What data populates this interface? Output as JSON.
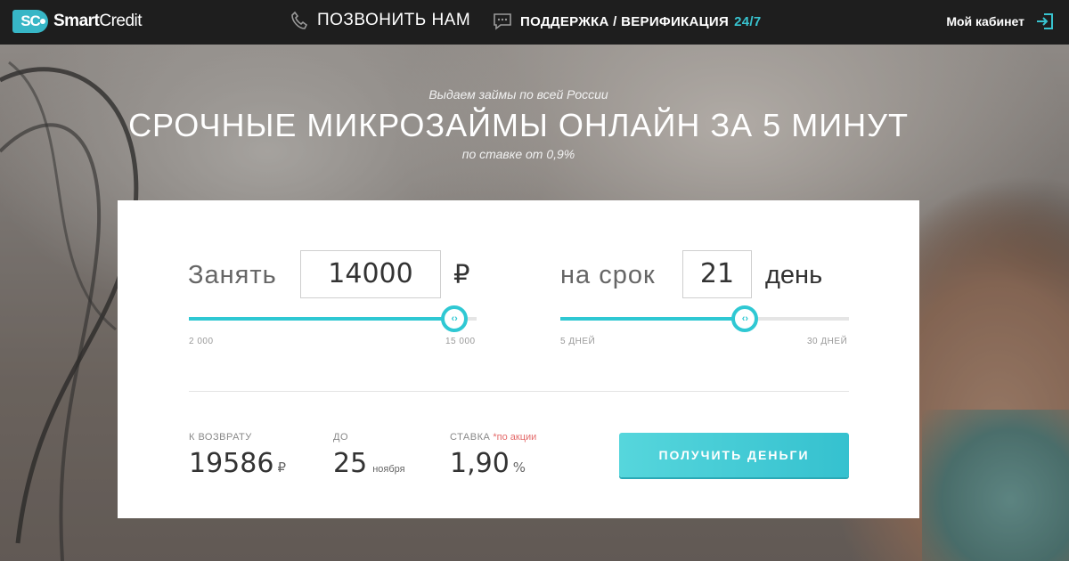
{
  "colors": {
    "accent": "#2fc8d3",
    "header_bg": "#1e1e1e",
    "promo": "#e46a6a"
  },
  "header": {
    "logo_badge": "SC",
    "logo_word1": "Smart",
    "logo_word2": "Credit",
    "call_label": "ПОЗВОНИТЬ НАМ",
    "call_icon": "phone-icon",
    "support_label": "ПОДДЕРЖКА / ВЕРИФИКАЦИЯ",
    "support_hours": "24/7",
    "support_icon": "chat-icon",
    "cabinet_label": "Мой кабинет",
    "cabinet_icon": "login-icon"
  },
  "hero": {
    "subtitle": "Выдаем займы по всей России",
    "title": "СРОЧНЫЕ МИКРОЗАЙМЫ ОНЛАЙН ЗА 5 МИНУТ",
    "rate_note": "по ставке от 0,9%"
  },
  "calculator": {
    "amount": {
      "label": "Занять",
      "value": "14000",
      "unit": "₽",
      "min_label": "2 000",
      "max_label": "15 000",
      "min": 2000,
      "max": 15000,
      "current": 14000
    },
    "term": {
      "label": "на срок",
      "value": "21",
      "unit": "день",
      "min_label": "5 ДНЕЙ",
      "max_label": "30 ДНЕЙ",
      "min": 5,
      "max": 30,
      "current": 21
    },
    "thumb_glyph": "‹›",
    "summary": {
      "return_label": "К ВОЗВРАТУ",
      "return_value": "19586",
      "return_unit": "₽",
      "due_label": "ДО",
      "due_day": "25",
      "due_month": "ноября",
      "rate_label": "СТАВКА",
      "rate_promo": "*по акции",
      "rate_value": "1,90",
      "rate_unit": "%"
    },
    "cta_label": "ПОЛУЧИТЬ ДЕНЬГИ"
  }
}
